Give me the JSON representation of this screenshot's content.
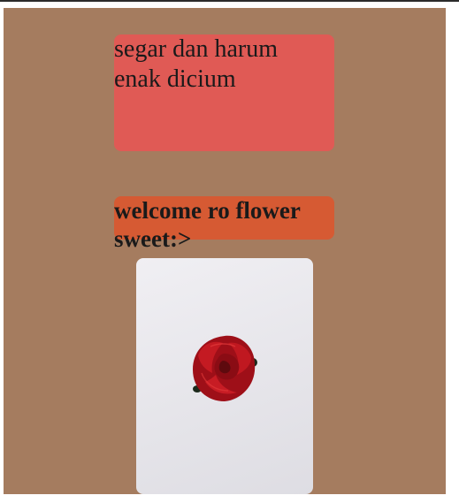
{
  "scent_card": {
    "line1": "segar dan harum",
    "line2": "enak dicium"
  },
  "welcome_card": {
    "heading": "welcome ro flower sweet:>"
  },
  "photo": {
    "subject": "red-rose-icon"
  },
  "colors": {
    "page_background": "#a57c5f",
    "scent_card": "#e05a55",
    "welcome_card": "#d65a33",
    "rose": "#b3141c"
  }
}
